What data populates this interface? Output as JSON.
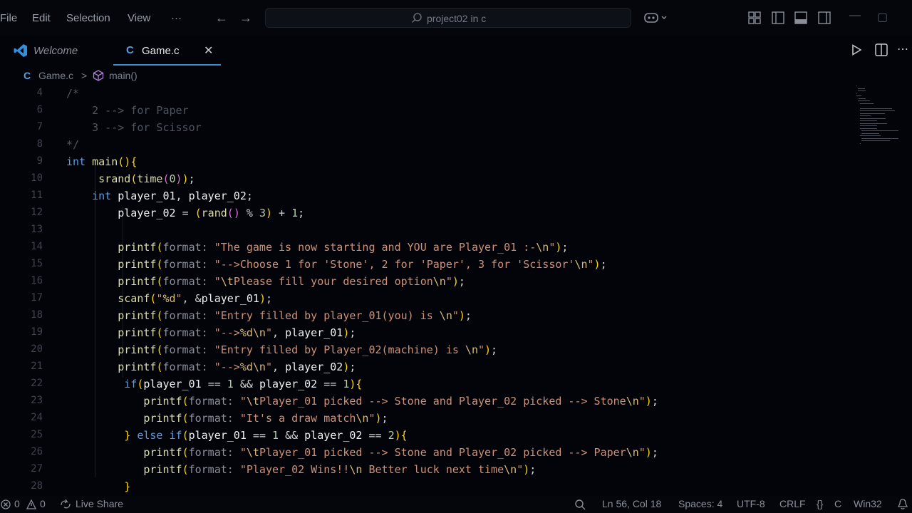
{
  "menu": [
    "File",
    "Edit",
    "Selection",
    "View"
  ],
  "menu_more": "···",
  "command_center": "project02 in c",
  "tabs": [
    {
      "label": "Welcome"
    },
    {
      "label": "Game.c",
      "icon": "C",
      "close": "✕"
    }
  ],
  "breadcrumb": {
    "icon": "C",
    "file": "Game.c",
    "separator": ">",
    "symbol": "main()"
  },
  "code_lines": [
    {
      "n": "4",
      "text": "/*"
    },
    {
      "n": "6",
      "text": "    2 --> for Paper"
    },
    {
      "n": "7",
      "text": "    3 --> for Scissor"
    },
    {
      "n": "8",
      "text": "*/"
    },
    {
      "n": "9",
      "text": "int main(){"
    },
    {
      "n": "10",
      "text": "     srand(time(0));"
    },
    {
      "n": "11",
      "text": "    int player_01, player_02;"
    },
    {
      "n": "12",
      "text": "        player_02 = (rand() % 3) + 1;"
    },
    {
      "n": "13",
      "text": ""
    },
    {
      "n": "14",
      "text": "        printf(format: \"The game is now starting and YOU are Player_01 :-\\n\");"
    },
    {
      "n": "15",
      "text": "        printf(format: \"-->Choose 1 for 'Stone', 2 for 'Paper', 3 for 'Scissor'\\n\");"
    },
    {
      "n": "16",
      "text": "        printf(format: \"\\tPlease fill your desired option\\n\");"
    },
    {
      "n": "17",
      "text": "        scanf(\"%d\", &player_01);"
    },
    {
      "n": "18",
      "text": "        printf(format: \"Entry filled by player_01(you) is \\n\");"
    },
    {
      "n": "19",
      "text": "        printf(format: \"-->%d\\n\", player_01);"
    },
    {
      "n": "20",
      "text": "        printf(format: \"Entry filled by Player_02(machine) is \\n\");"
    },
    {
      "n": "21",
      "text": "        printf(format: \"-->%d\\n\", player_02);"
    },
    {
      "n": "22",
      "text": "         if(player_01 == 1 && player_02 == 1){"
    },
    {
      "n": "23",
      "text": "            printf(format: \"\\tPlayer_01 picked --> Stone and Player_02 picked --> Stone\\n\");"
    },
    {
      "n": "24",
      "text": "            printf(format: \"It's a draw match\\n\");"
    },
    {
      "n": "25",
      "text": "         } else if(player_01 == 1 && player_02 == 2){"
    },
    {
      "n": "26",
      "text": "            printf(format: \"\\tPlayer_01 picked --> Stone and Player_02 picked --> Paper\\n\");"
    },
    {
      "n": "27",
      "text": "            printf(format: \"Player_02 Wins!!\\n Better luck next time\\n\");"
    },
    {
      "n": "28",
      "text": "         }"
    }
  ],
  "status": {
    "errors": "0",
    "warnings": "0",
    "live_share": "Live Share",
    "position": "Ln 56, Col 18",
    "spaces": "Spaces: 4",
    "encoding": "UTF-8",
    "eol": "CRLF",
    "language": "C",
    "platform": "Win32"
  },
  "colors": {
    "accent": "#3d8bd4",
    "background": "#020409"
  }
}
